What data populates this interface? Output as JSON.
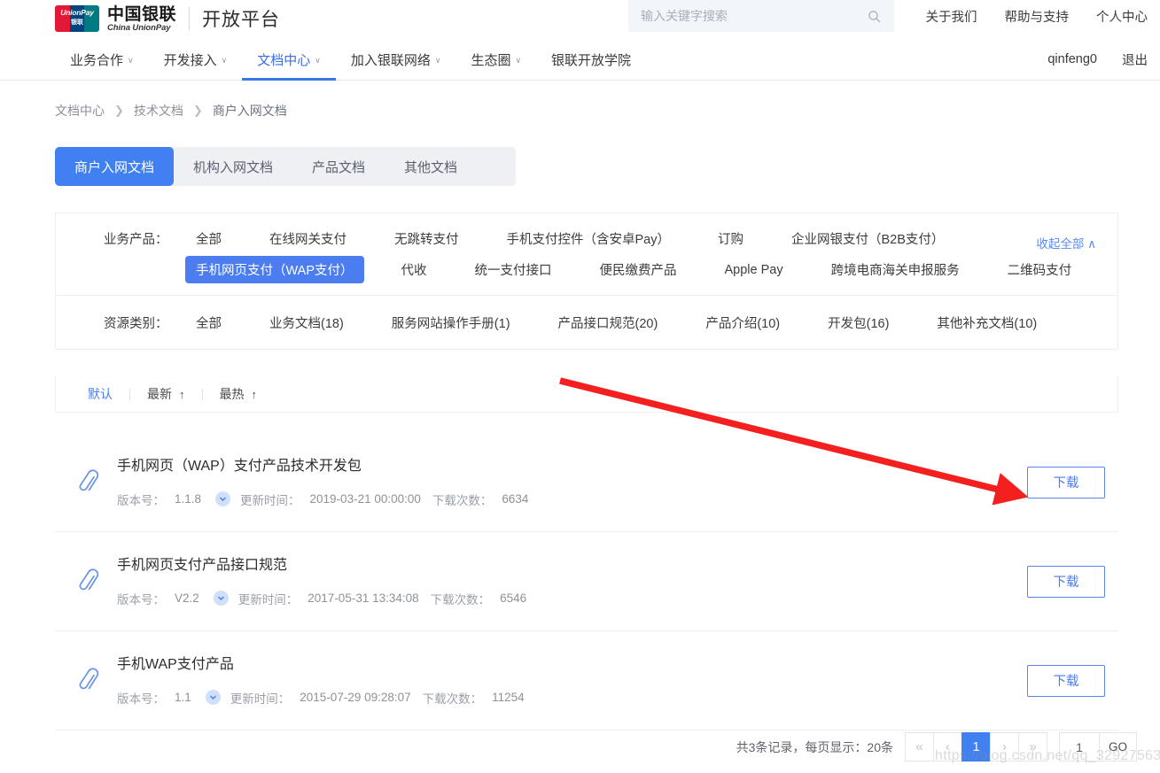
{
  "brand": {
    "card_line1": "UnionPay",
    "card_line2": "银联",
    "name_cn": "中国银联",
    "name_en": "China UnionPay",
    "platform": "开放平台"
  },
  "search": {
    "placeholder": "输入关键字搜索",
    "value": "",
    "icon": "search-icon"
  },
  "top_links": [
    "关于我们",
    "帮助与支持",
    "个人中心"
  ],
  "nav": {
    "items": [
      {
        "label": "业务合作",
        "caret": true,
        "active": false
      },
      {
        "label": "开发接入",
        "caret": true,
        "active": false
      },
      {
        "label": "文档中心",
        "caret": true,
        "active": true
      },
      {
        "label": "加入银联网络",
        "caret": true,
        "active": false
      },
      {
        "label": "生态圈",
        "caret": true,
        "active": false
      },
      {
        "label": "银联开放学院",
        "caret": false,
        "active": false
      }
    ],
    "user": "qinfeng0",
    "logout": "退出"
  },
  "breadcrumb": [
    "文档中心",
    "技术文档",
    "商户入网文档"
  ],
  "tabs": [
    {
      "label": "商户入网文档",
      "active": true
    },
    {
      "label": "机构入网文档",
      "active": false
    },
    {
      "label": "产品文档",
      "active": false
    },
    {
      "label": "其他文档",
      "active": false
    }
  ],
  "filters": {
    "product": {
      "label": "业务产品：",
      "row1": [
        {
          "label": "全部",
          "selected": false
        },
        {
          "label": "在线网关支付",
          "selected": false
        },
        {
          "label": "无跳转支付",
          "selected": false
        },
        {
          "label": "手机支付控件（含安卓Pay）",
          "selected": false
        },
        {
          "label": "订购",
          "selected": false
        },
        {
          "label": "企业网银支付（B2B支付）",
          "selected": false
        }
      ],
      "row2": [
        {
          "label": "手机网页支付（WAP支付）",
          "selected": true
        },
        {
          "label": "代收",
          "selected": false
        },
        {
          "label": "统一支付接口",
          "selected": false
        },
        {
          "label": "便民缴费产品",
          "selected": false
        },
        {
          "label": "Apple Pay",
          "selected": false
        },
        {
          "label": "跨境电商海关申报服务",
          "selected": false
        },
        {
          "label": "二维码支付",
          "selected": false
        }
      ],
      "collapse_all": "收起全部 ∧"
    },
    "resource": {
      "label": "资源类别：",
      "options": [
        {
          "label": "全部",
          "selected": false
        },
        {
          "label": "业务文档(18)",
          "selected": false
        },
        {
          "label": "服务网站操作手册(1)",
          "selected": false
        },
        {
          "label": "产品接口规范(20)",
          "selected": false
        },
        {
          "label": "产品介绍(10)",
          "selected": false
        },
        {
          "label": "开发包(16)",
          "selected": false
        },
        {
          "label": "其他补充文档(10)",
          "selected": false
        }
      ]
    }
  },
  "sort": [
    {
      "label": "默认",
      "arrow": "",
      "active": true
    },
    {
      "label": "最新",
      "arrow": "↑",
      "active": false
    },
    {
      "label": "最热",
      "arrow": "↑",
      "active": false
    }
  ],
  "doc_meta_labels": {
    "version": "版本号：",
    "updated": "更新时间：",
    "downloads": "下载次数："
  },
  "documents": [
    {
      "title": "手机网页（WAP）支付产品技术开发包",
      "version": "1.1.8",
      "updated": "2019-03-21 00:00:00",
      "downloads": "6634",
      "download_label": "下载"
    },
    {
      "title": "手机网页支付产品接口规范",
      "version": "V2.2",
      "updated": "2017-05-31 13:34:08",
      "downloads": "6546",
      "download_label": "下载"
    },
    {
      "title": "手机WAP支付产品",
      "version": "1.1",
      "updated": "2015-07-29 09:28:07",
      "downloads": "11254",
      "download_label": "下载"
    }
  ],
  "pagination": {
    "info": "共3条记录，每页显示：20条",
    "first": "«",
    "prev": "‹",
    "pages": [
      {
        "label": "1",
        "active": true
      }
    ],
    "next": "›",
    "last": "»",
    "jump_value": "1",
    "go_label": "GO"
  },
  "watermark": "https://blog.csdn.net/qq_32927563",
  "colors": {
    "accent_blue": "#4080f0",
    "tab_blue": "#4080f0",
    "link_blue": "#5b8bf5",
    "annotation_red": "#f42020",
    "unionpay_red": "#e21836",
    "unionpay_blue": "#00447c",
    "unionpay_green": "#007b84"
  }
}
